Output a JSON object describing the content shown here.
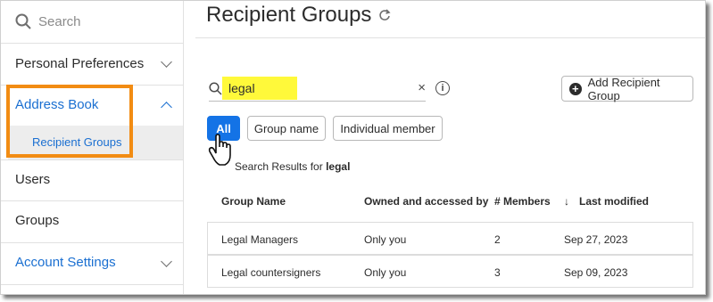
{
  "sidebar": {
    "search_label": "Search",
    "items": [
      {
        "label": "Personal Preferences"
      },
      {
        "label": "Address Book"
      },
      {
        "label": "Recipient Groups"
      },
      {
        "label": "Users"
      },
      {
        "label": "Groups"
      },
      {
        "label": "Account Settings"
      }
    ]
  },
  "main": {
    "title": "Recipient Groups",
    "search": {
      "value": "legal",
      "clear": "×"
    },
    "add_button": "Add Recipient Group",
    "filters": [
      "All",
      "Group name",
      "Individual member"
    ],
    "results": {
      "prefix": "Search Results for",
      "term": "legal"
    },
    "table": {
      "headers": [
        "Group Name",
        "Owned and accessed by",
        "# Members",
        "Last modified"
      ],
      "sort_arrow": "↓",
      "rows": [
        [
          "Legal Managers",
          "Only you",
          "2",
          "Sep 27, 2023"
        ],
        [
          "Legal countersigners",
          "Only you",
          "3",
          "Sep 09, 2023"
        ]
      ]
    }
  },
  "colors": {
    "accent": "#1473e6",
    "link": "#1a6fd1",
    "highlight_box": "#f28c13",
    "search_highlight": "#fff93a"
  }
}
